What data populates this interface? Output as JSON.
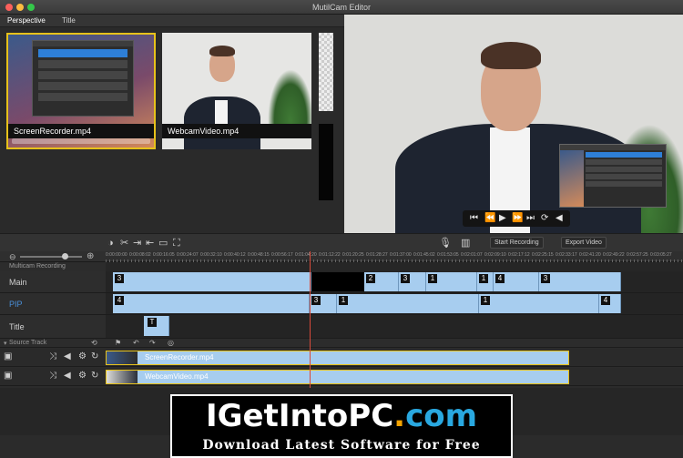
{
  "window": {
    "title": "MutilCam Editor"
  },
  "tabs": [
    {
      "label": "Perspective"
    },
    {
      "label": "Title"
    }
  ],
  "library": {
    "clips": [
      {
        "label": "ScreenRecorder.mp4"
      },
      {
        "label": "WebcamVideo.mp4"
      }
    ]
  },
  "toolbar": {
    "start_recording_label": "Start Recording",
    "export_video_label": "Export Video"
  },
  "ruler": {
    "ticks": [
      "0:00:00:00",
      "0:00:08:02",
      "0:00:16:05",
      "0:00:24:07",
      "0:00:32:10",
      "0:00:40:12",
      "0:00:48:15",
      "0:00:56:17",
      "0:01:04:20",
      "0:01:12:22",
      "0:01:20:25",
      "0:01:28:27",
      "0:01:37:00",
      "0:01:45:02",
      "0:01:53:05",
      "0:02:01:07",
      "0:02:09:10",
      "0:02:17:12",
      "0:02:25:15",
      "0:02:33:17",
      "0:02:41:20",
      "0:02:49:22",
      "0:02:57:25",
      "0:03:05:27",
      "0:03:14:00"
    ]
  },
  "sections": {
    "multicam": "Multicam Recording",
    "source": "Source Track"
  },
  "tracks": {
    "main": "Main",
    "pip": "PIP",
    "title": "Title"
  },
  "markers": {
    "main": [
      "3",
      "2",
      "3",
      "1",
      "1",
      "4",
      "3"
    ],
    "pip": [
      "4",
      "3",
      "1",
      "1",
      "4"
    ],
    "title": [
      "T"
    ]
  },
  "source_tracks": [
    {
      "label": "ScreenRecorder.mp4"
    },
    {
      "label": "WebcamVideo.mp4"
    }
  ],
  "watermark": {
    "brand_main": "IGetIntoPC",
    "brand_dot": ".",
    "brand_tld": "com",
    "tagline": "Download Latest Software for Free"
  }
}
